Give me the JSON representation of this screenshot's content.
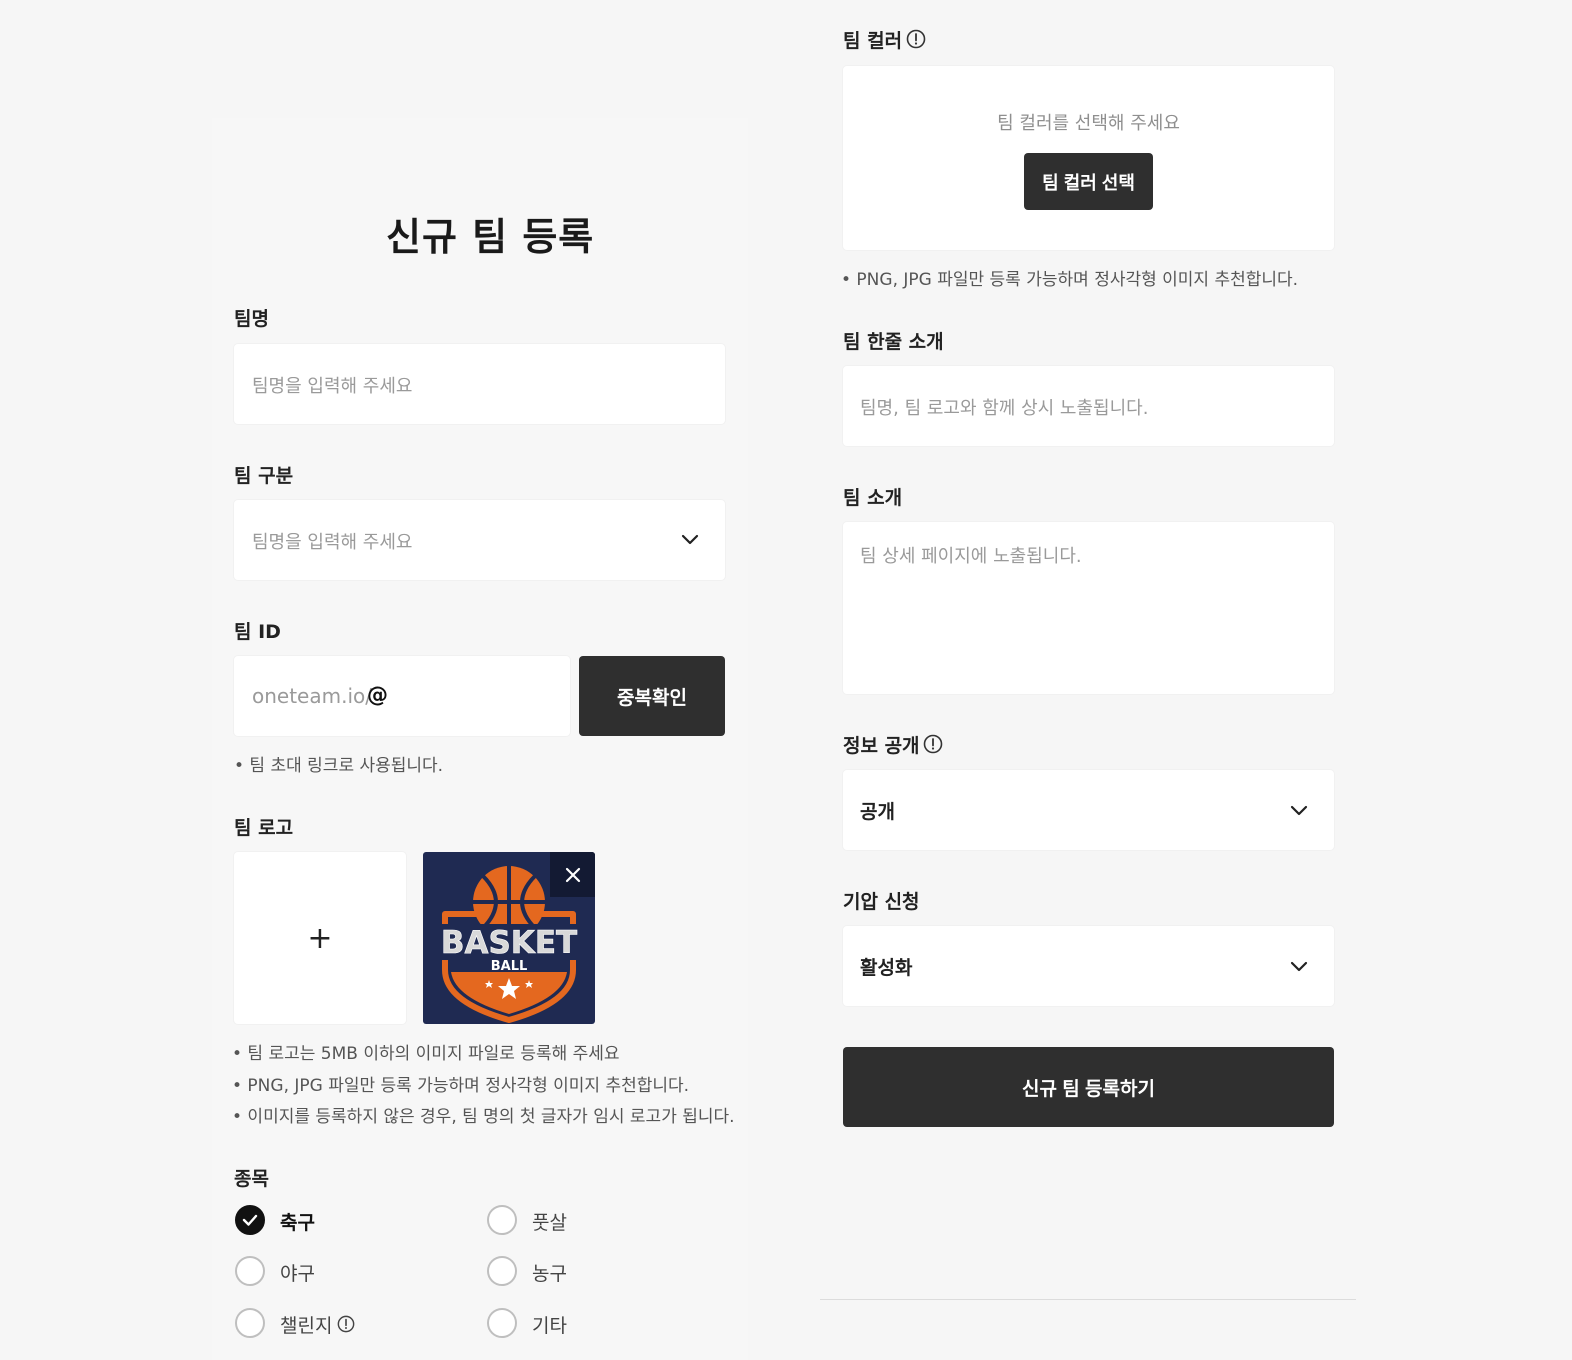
{
  "page_title": "신규 팀 등록",
  "team_name": {
    "label": "팀명",
    "placeholder": "팀명을 입력해 주세요"
  },
  "team_type": {
    "label": "팀 구분",
    "placeholder": "팀명을 입력해 주세요"
  },
  "team_id": {
    "label": "팀 ID",
    "prefix": "oneteam.io/",
    "at": "@",
    "check_button": "중복확인",
    "note": "• 팀 초대 링크로 사용됩니다."
  },
  "team_logo": {
    "label": "팀 로고",
    "add_symbol": "+",
    "logo_text_main": "BASKET",
    "logo_text_sub": "BALL",
    "notes": [
      "• 팀 로고는 5MB 이하의 이미지 파일로 등록해 주세요",
      "• PNG, JPG 파일만 등록 가능하며 정사각형 이미지 추천합니다.",
      "• 이미지를 등록하지 않은 경우, 팀 명의 첫 글자가 임시 로고가 됩니다."
    ]
  },
  "sport": {
    "label": "종목",
    "options": [
      {
        "label": "축구",
        "checked": true
      },
      {
        "label": "풋살",
        "checked": false
      },
      {
        "label": "야구",
        "checked": false
      },
      {
        "label": "농구",
        "checked": false
      },
      {
        "label": "챌린지",
        "checked": false
      },
      {
        "label": "기타",
        "checked": false
      }
    ]
  },
  "team_color": {
    "label": "팀 컬러",
    "prompt": "팀 컬러를 선택해 주세요",
    "button": "팀 컬러 선택",
    "note": "• PNG, JPG 파일만 등록 가능하며 정사각형 이미지 추천합니다."
  },
  "team_oneliner": {
    "label": "팀 한줄 소개",
    "placeholder": "팀명, 팀 로고와 함께 상시 노출됩니다."
  },
  "team_intro": {
    "label": "팀 소개",
    "placeholder": "팀 상세 페이지에 노출됩니다."
  },
  "visibility": {
    "label": "정보 공개",
    "value": "공개"
  },
  "join_request": {
    "label": "기압 신청",
    "value": "활성화"
  },
  "submit_button": "신규 팀 등록하기",
  "colors": {
    "dark_button": "#2f2f2f",
    "logo_bg": "#1f2a52",
    "logo_orange": "#e4681f"
  }
}
